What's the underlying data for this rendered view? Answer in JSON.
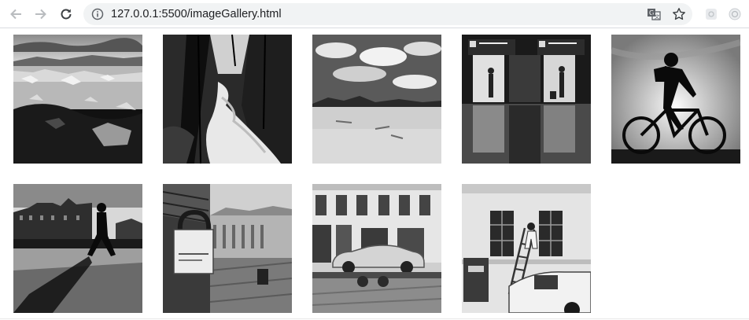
{
  "browser": {
    "url": "127.0.0.1:5500/imageGallery.html",
    "icons": {
      "back": "back-arrow-icon",
      "forward": "forward-arrow-icon",
      "reload": "reload-icon",
      "info": "site-info-icon",
      "translate": "translate-icon",
      "bookmark": "bookmark-star-icon",
      "extension1": "extension-icon",
      "extension2": "extension-icon"
    }
  },
  "gallery": {
    "images": [
      {
        "subject": "icebergs lagoon"
      },
      {
        "subject": "forest waterfall"
      },
      {
        "subject": "desert with clouds"
      },
      {
        "subject": "train doors reflections"
      },
      {
        "subject": "cyclist silhouette"
      },
      {
        "subject": "walking silhouette cityscape"
      },
      {
        "subject": "padlock street"
      },
      {
        "subject": "car on trailer"
      },
      {
        "subject": "painter on ladder with van"
      }
    ]
  },
  "colors": {
    "toolbar_bg": "#ffffff",
    "omnibox_bg": "#f1f3f4",
    "icon_gray": "#5f6368",
    "disabled_icon_gray": "#b9bcbf"
  }
}
